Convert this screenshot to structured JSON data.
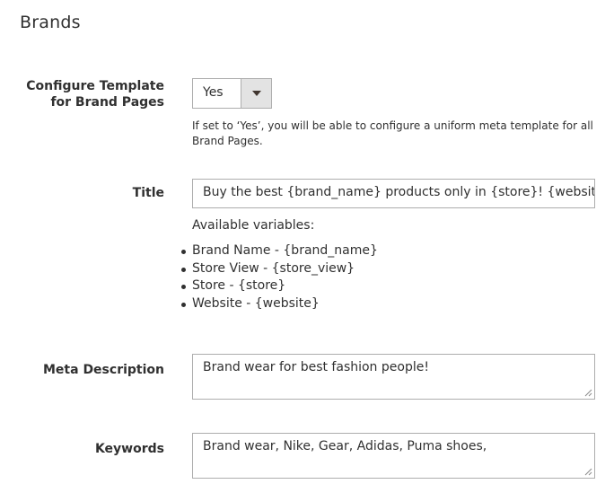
{
  "section": {
    "title": "Brands"
  },
  "configure_template": {
    "label": "Configure Template for Brand Pages",
    "selected": "Yes",
    "note": "If set to ‘Yes’, you will be able to configure a uniform meta template for all Brand Pages."
  },
  "title_field": {
    "label": "Title",
    "value": "Buy the best {brand_name} products only in {store}! {website}",
    "vars_heading": "Available variables:",
    "vars": [
      "Brand Name - {brand_name}",
      "Store View - {store_view}",
      "Store - {store}",
      "Website - {website}"
    ]
  },
  "meta_description": {
    "label": "Meta Description",
    "value": "Brand wear for best fashion people!"
  },
  "keywords": {
    "label": "Keywords",
    "value": "Brand wear, Nike, Gear, Adidas, Puma shoes,"
  },
  "icons": {
    "select_arrow": "caret-down-icon",
    "resize": "resize-handle-icon"
  }
}
